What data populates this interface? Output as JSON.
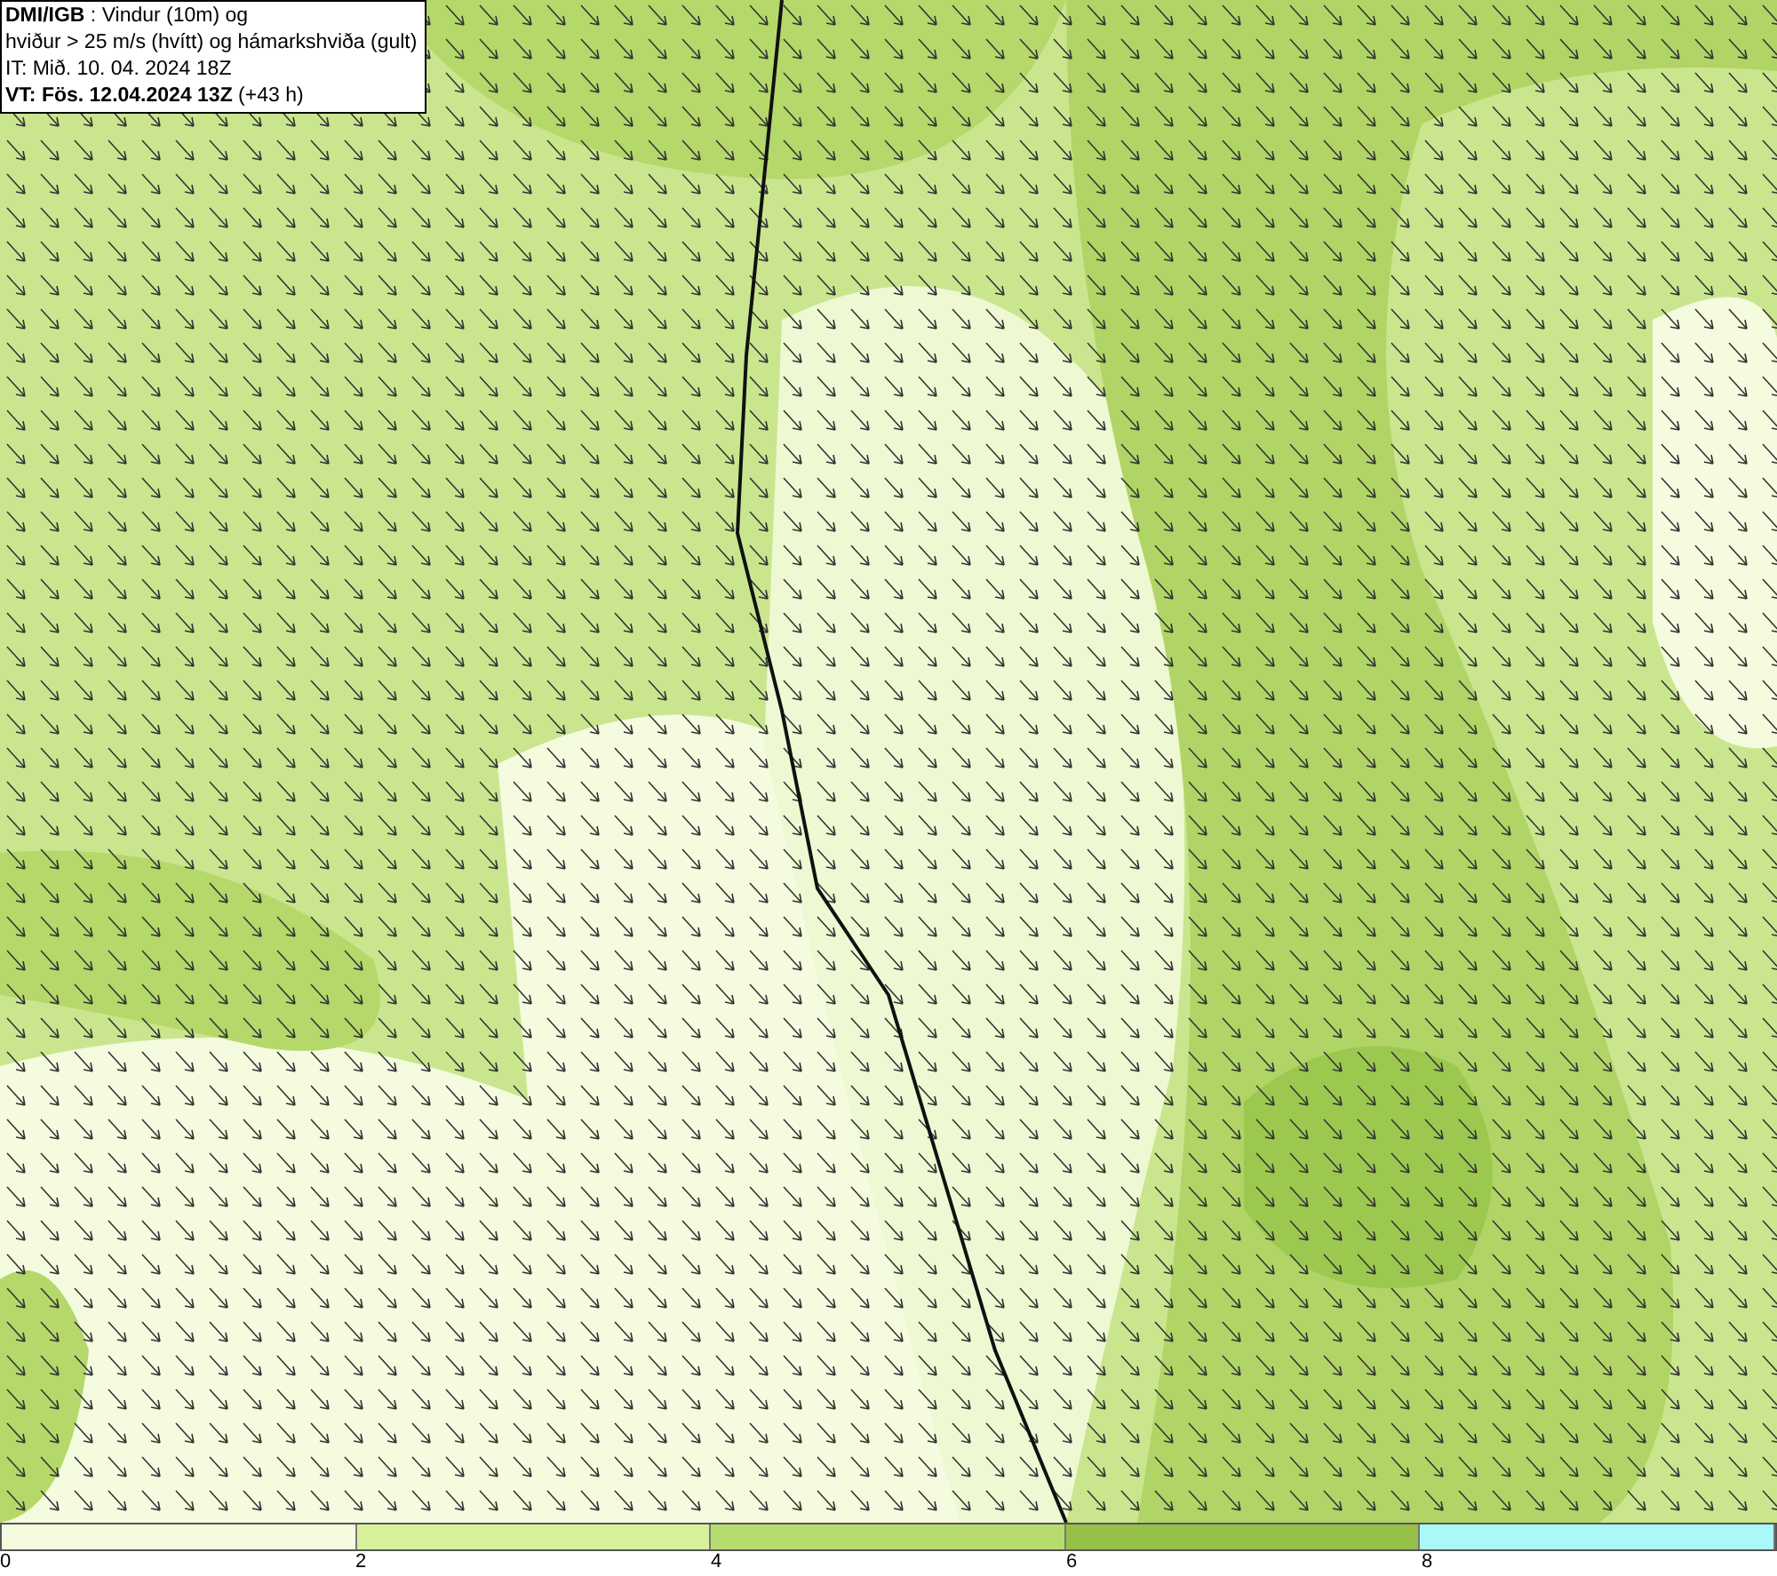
{
  "legend": {
    "lines": [
      "**DMI/IGB** : Vindur (10m) og",
      "hviður > 25 m/s (hvítt) og hámarkshviða (gult)",
      "IT: Mið. 10. 04. 2024 18Z",
      "**VT: Fös. 12.04.2024 13Z** (+43 h)"
    ]
  },
  "color_bar": {
    "segments": [
      {
        "color": "#f4fbdf"
      },
      {
        "color": "#d6f09c"
      },
      {
        "color": "#b6dc70"
      },
      {
        "color": "#96c048"
      },
      {
        "color": "#aaf8f8"
      }
    ],
    "ticks": [
      "0",
      "2",
      "4",
      "6",
      "8"
    ]
  }
}
